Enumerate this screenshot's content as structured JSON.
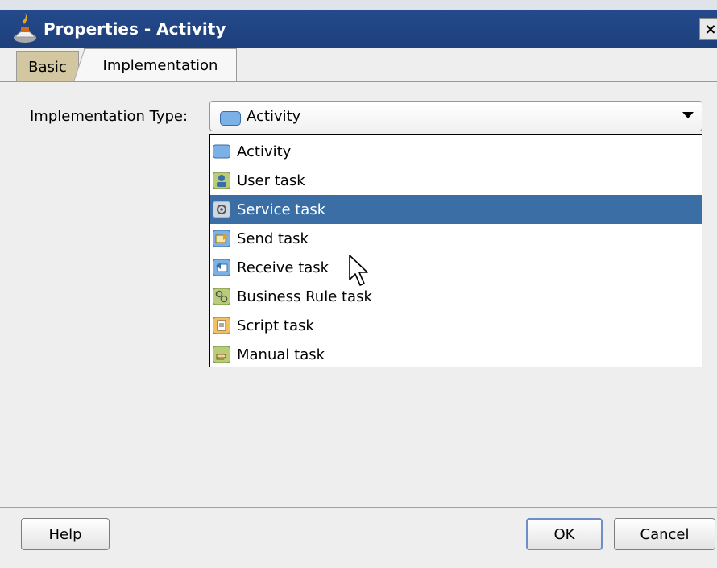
{
  "window": {
    "title": "Properties - Activity",
    "close_label": "×"
  },
  "tabs": [
    {
      "label": "Basic"
    },
    {
      "label": "Implementation",
      "active": true
    }
  ],
  "implementation": {
    "label": "Implementation Type:",
    "selected_value": "Activity",
    "options": [
      {
        "label": "Activity",
        "icon": "activity-icon"
      },
      {
        "label": "User task",
        "icon": "user-task-icon"
      },
      {
        "label": "Service task",
        "icon": "service-task-icon",
        "highlighted": true
      },
      {
        "label": "Send task",
        "icon": "send-task-icon"
      },
      {
        "label": "Receive task",
        "icon": "receive-task-icon"
      },
      {
        "label": "Business Rule task",
        "icon": "business-rule-task-icon"
      },
      {
        "label": "Script task",
        "icon": "script-task-icon"
      },
      {
        "label": "Manual task",
        "icon": "manual-task-icon"
      }
    ]
  },
  "buttons": {
    "help": "Help",
    "ok": "OK",
    "cancel": "Cancel"
  },
  "colors": {
    "titlebar": "#244a8c",
    "selection": "#3a6ea5",
    "active_tab": "#d2c7a1"
  }
}
